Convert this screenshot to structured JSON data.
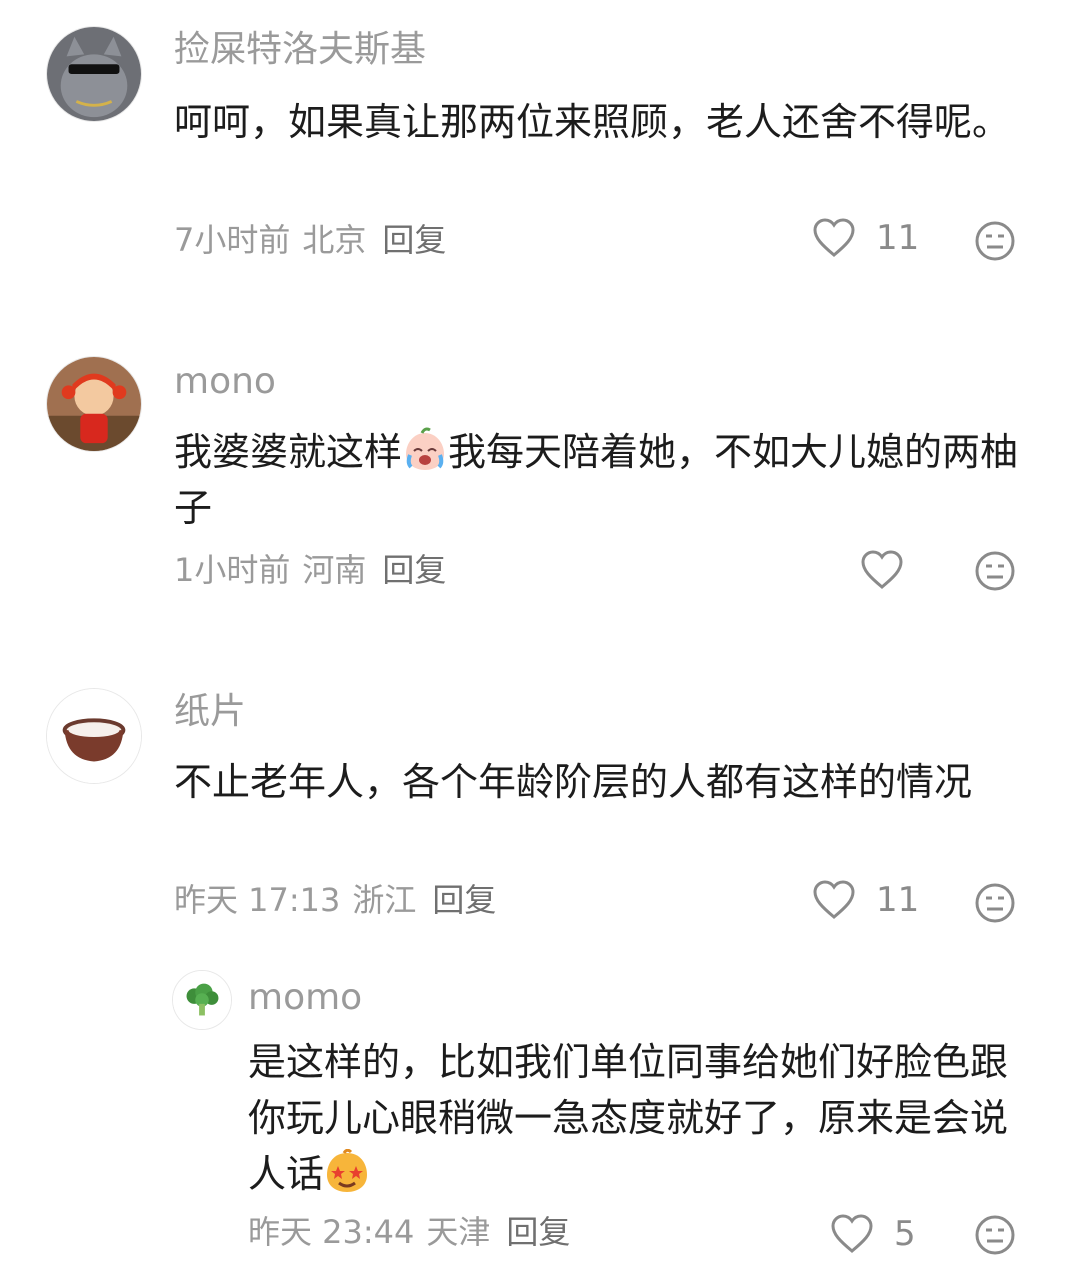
{
  "reply_label": "回复",
  "comments": [
    {
      "username": "捡屎特洛夫斯基",
      "content": "呵呵，如果真让那两位来照顾，老人还舍不得呢。",
      "time": "7小时前",
      "location": "北京",
      "likes": "11"
    },
    {
      "username": "mono",
      "content_before": "我婆婆就这样",
      "content_after": "我每天陪着她，不如大儿媳的两柚子",
      "time": "1小时前",
      "location": "河南",
      "likes": ""
    },
    {
      "username": "纸片",
      "content": "不止老年人，各个年龄阶层的人都有这样的情况",
      "time": "昨天 17:13",
      "location": "浙江",
      "likes": "11"
    },
    {
      "username": "momo",
      "content_before": "是这样的，比如我们单位同事给她们好脸色跟你玩儿心眼稍微一急态度就好了，原来是会说人话",
      "time": "昨天 23:44",
      "location": "天津",
      "likes": "5"
    }
  ],
  "icons": {
    "like": "heart-outline-icon",
    "dislike": "neutral-face-icon",
    "emoji_crying": "crying-peach-emoji",
    "emoji_starstruck": "star-eyes-emoji"
  }
}
